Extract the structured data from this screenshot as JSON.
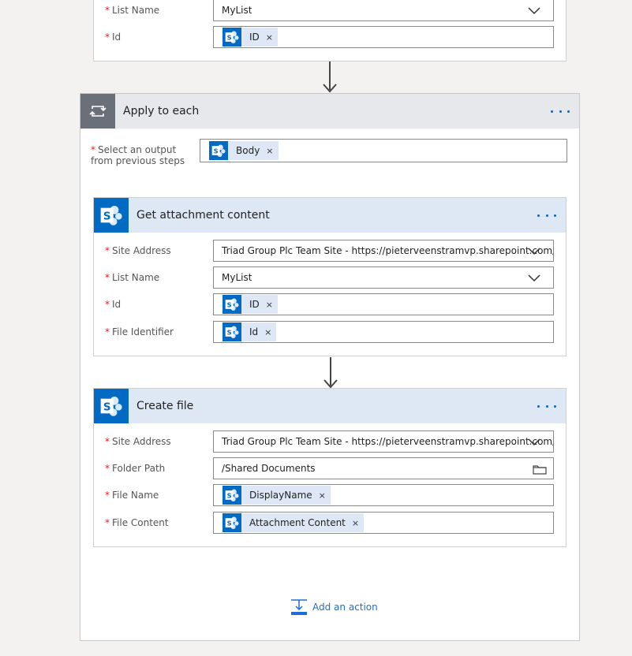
{
  "top_card": {
    "list_name_label": "List Name",
    "list_name_value": "MyList",
    "id_label": "Id",
    "id_token": "ID"
  },
  "apply_each": {
    "title": "Apply to each",
    "select_label_line1": "Select an output",
    "select_label_line2": "from previous steps",
    "body_token": "Body"
  },
  "get_attachment": {
    "title": "Get attachment content",
    "site_address_label": "Site Address",
    "site_address_value": "Triad Group Plc Team Site - https://pieterveenstramvp.sharepoint.com/",
    "list_name_label": "List Name",
    "list_name_value": "MyList",
    "id_label": "Id",
    "id_token": "ID",
    "file_identifier_label": "File Identifier",
    "file_identifier_token": "Id"
  },
  "create_file": {
    "title": "Create file",
    "site_address_label": "Site Address",
    "site_address_value": "Triad Group Plc Team Site - https://pieterveenstramvp.sharepoint.com/",
    "folder_path_label": "Folder Path",
    "folder_path_value": "/Shared Documents",
    "file_name_label": "File Name",
    "file_name_token": "DisplayName",
    "file_content_label": "File Content",
    "file_content_token": "Attachment Content"
  },
  "add_action_label": "Add an action",
  "remove_glyph": "×",
  "required_mark": "*",
  "colors": {
    "sharepoint_blue": "#036ac4",
    "token_bg": "#dde7f5",
    "header_bg": "#dde8f4",
    "loop_header": "#69707a",
    "link_blue": "#1a6fd0",
    "required_red": "#e01e1e"
  }
}
